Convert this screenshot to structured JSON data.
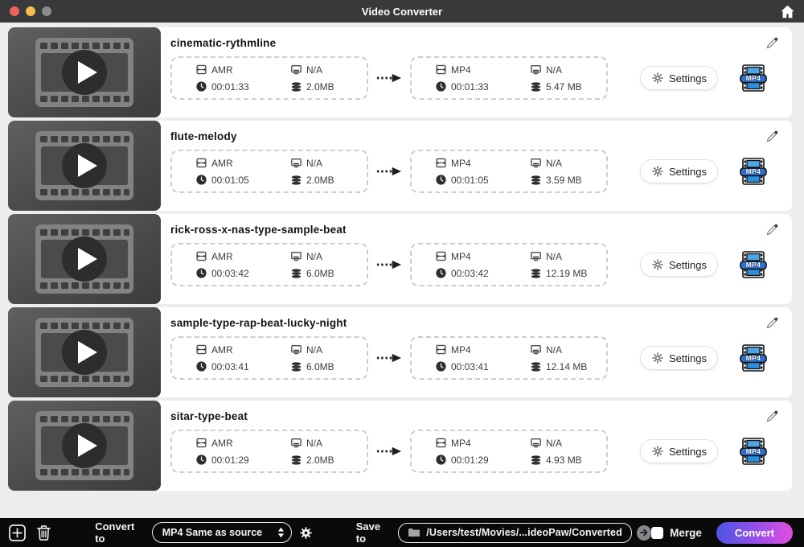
{
  "window": {
    "title": "Video Converter"
  },
  "labels": {
    "settings": "Settings"
  },
  "rows": [
    {
      "name": "cinematic-rythmline",
      "source": {
        "format": "AMR",
        "resolution": "N/A",
        "duration": "00:01:33",
        "size": "2.0MB"
      },
      "target": {
        "format": "MP4",
        "resolution": "N/A",
        "duration": "00:01:33",
        "size": "5.47 MB"
      }
    },
    {
      "name": "flute-melody",
      "source": {
        "format": "AMR",
        "resolution": "N/A",
        "duration": "00:01:05",
        "size": "2.0MB"
      },
      "target": {
        "format": "MP4",
        "resolution": "N/A",
        "duration": "00:01:05",
        "size": "3.59 MB"
      }
    },
    {
      "name": "rick-ross-x-nas-type-sample-beat",
      "source": {
        "format": "AMR",
        "resolution": "N/A",
        "duration": "00:03:42",
        "size": "6.0MB"
      },
      "target": {
        "format": "MP4",
        "resolution": "N/A",
        "duration": "00:03:42",
        "size": "12.19 MB"
      }
    },
    {
      "name": "sample-type-rap-beat-lucky-night",
      "source": {
        "format": "AMR",
        "resolution": "N/A",
        "duration": "00:03:41",
        "size": "6.0MB"
      },
      "target": {
        "format": "MP4",
        "resolution": "N/A",
        "duration": "00:03:41",
        "size": "12.14 MB"
      }
    },
    {
      "name": "sitar-type-beat",
      "source": {
        "format": "AMR",
        "resolution": "N/A",
        "duration": "00:01:29",
        "size": "2.0MB"
      },
      "target": {
        "format": "MP4",
        "resolution": "N/A",
        "duration": "00:01:29",
        "size": "4.93 MB"
      }
    }
  ],
  "toolbar": {
    "convert_to_label": "Convert to",
    "format_select_value": "MP4 Same as source",
    "save_to_label": "Save to",
    "save_path": "/Users/test/Movies/...ideoPaw/Converted",
    "merge_label": "Merge",
    "convert_label": "Convert"
  },
  "colors": {
    "accent_gradient_start": "#4d55e5",
    "accent_gradient_end": "#e24fe0",
    "badge_blue": "#2f8fd8",
    "titlebar": "#39393b",
    "toolbar": "#0a0a0a"
  }
}
